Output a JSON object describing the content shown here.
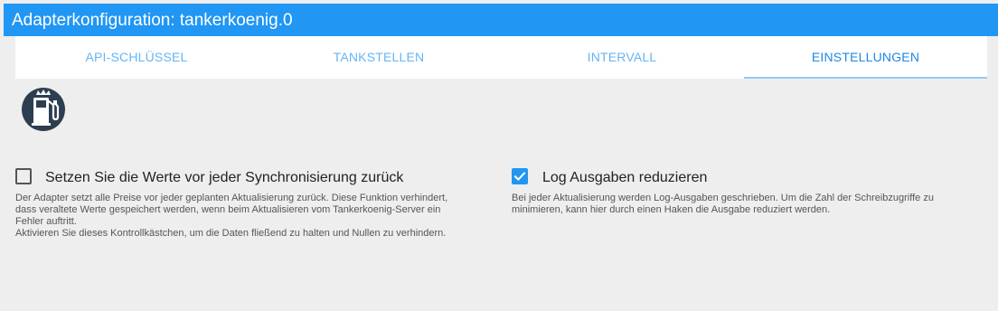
{
  "window": {
    "title": "Adapterkonfiguration: tankerkoenig.0"
  },
  "tabs": [
    {
      "label": "API-SCHLÜSSEL",
      "active": false
    },
    {
      "label": "TANKSTELLEN",
      "active": false
    },
    {
      "label": "INTERVALL",
      "active": false
    },
    {
      "label": "EINSTELLUNGEN",
      "active": true
    }
  ],
  "logo": {
    "icon": "fuel-pump-icon"
  },
  "settings": {
    "reset_values": {
      "label": "Setzen Sie die Werte vor jeder Synchronisierung zurück",
      "checked": false,
      "help": [
        "Der Adapter setzt alle Preise vor jeder geplanten Aktualisierung zurück. Diese Funktion verhindert,",
        "dass veraltete Werte gespeichert werden, wenn beim Aktualisieren vom Tankerkoenig-Server ein",
        "Fehler auftritt.",
        "Aktivieren Sie dieses Kontrollkästchen, um die Daten fließend zu halten und Nullen zu verhindern."
      ]
    },
    "reduce_log": {
      "label": "Log Ausgaben reduzieren",
      "checked": true,
      "help": [
        "Bei jeder Aktualisierung werden Log-Ausgaben geschrieben. Um die Zahl der Schreibzugriffe zu",
        "minimieren, kann hier durch einen Haken die Ausgabe reduziert werden."
      ]
    }
  },
  "colors": {
    "primary": "#2196f3",
    "tab_text": "#64b5f6",
    "background": "#eeeeee"
  }
}
